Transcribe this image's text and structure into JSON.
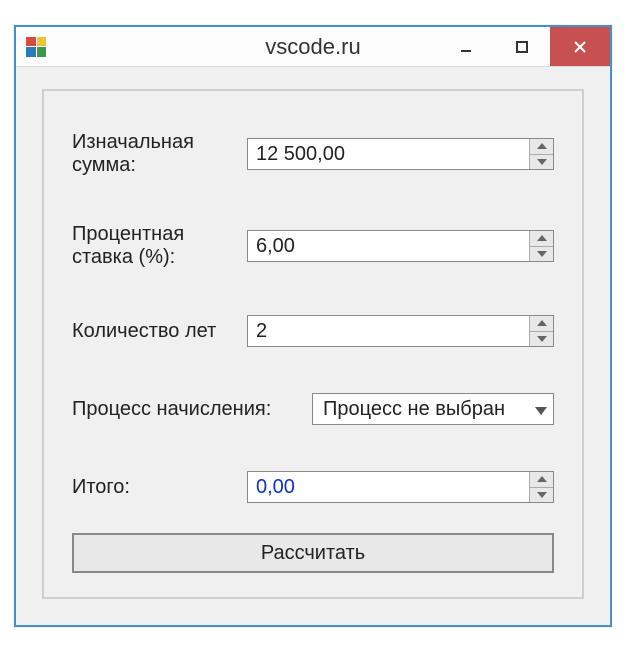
{
  "window": {
    "title": "vscode.ru"
  },
  "form": {
    "initialAmount": {
      "label": "Изначальная сумма:",
      "value": "12 500,00"
    },
    "interestRate": {
      "label": "Процентная ставка (%):",
      "value": "6,00"
    },
    "years": {
      "label": "Количество лет",
      "value": "2"
    },
    "process": {
      "label": "Процесс начисления:",
      "selected": "Процесс не выбран"
    },
    "total": {
      "label": "Итого:",
      "value": "0,00"
    }
  },
  "actions": {
    "calculate": "Рассчитать"
  }
}
